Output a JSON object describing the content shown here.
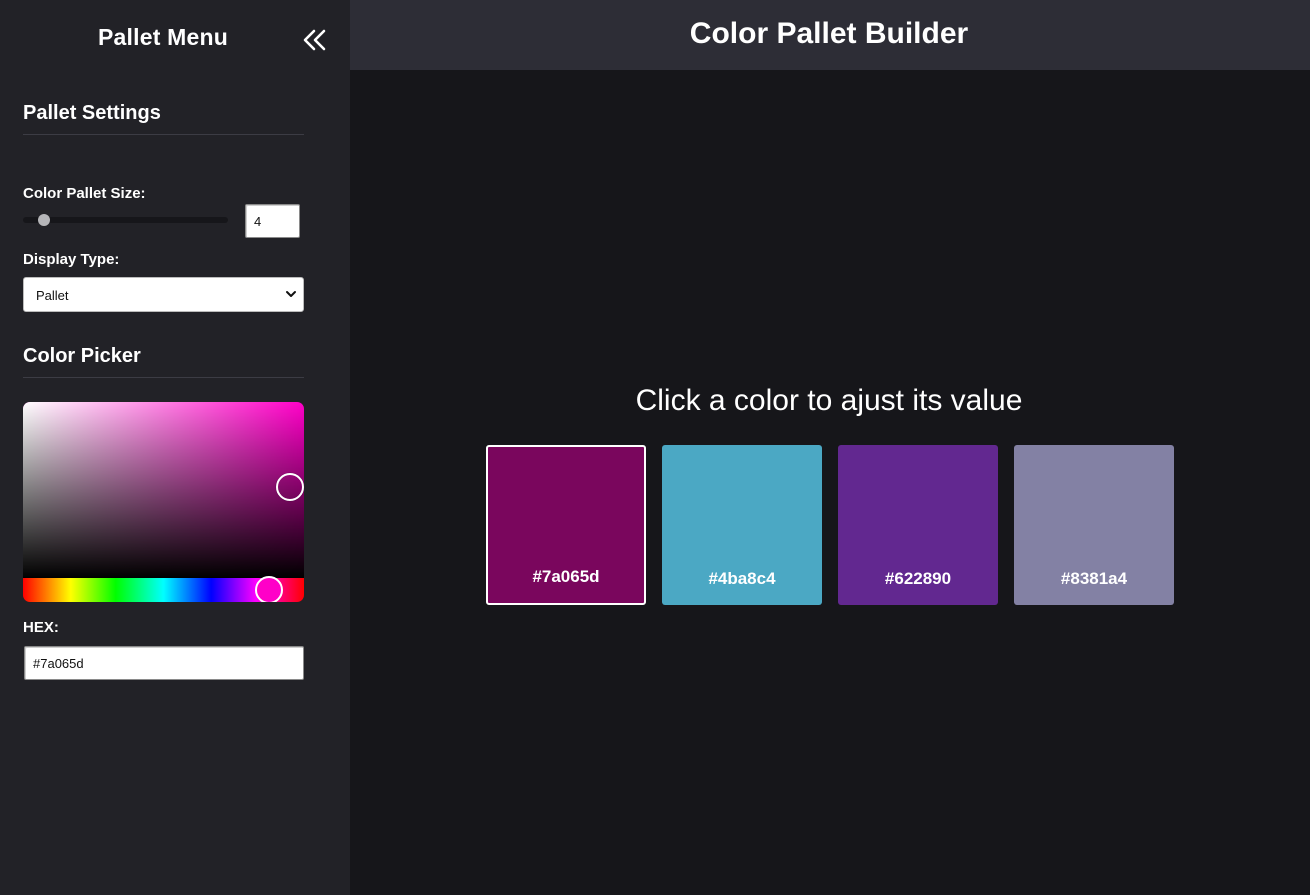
{
  "sidebar": {
    "title": "Pallet Menu",
    "collapse_icon": "double-chevron-left-icon",
    "settings_heading": "Pallet Settings",
    "size_label": "Color Pallet Size:",
    "size_value": "4",
    "display_label": "Display Type:",
    "display_value": "Pallet",
    "picker_heading": "Color Picker",
    "hex_label": "HEX:",
    "hex_value": "#7a065d"
  },
  "header": {
    "title": "Color Pallet Builder"
  },
  "main": {
    "instruction": "Click a color to ajust its value",
    "swatches": [
      {
        "hex": "#7a065d",
        "color": "#7a065d",
        "selected": true
      },
      {
        "hex": "#4ba8c4",
        "color": "#4ba8c4",
        "selected": false
      },
      {
        "hex": "#622890",
        "color": "#622890",
        "selected": false
      },
      {
        "hex": "#8381a4",
        "color": "#8381a4",
        "selected": false
      }
    ]
  },
  "colors": {
    "sidebar_bg": "#222227",
    "header_bg": "#2d2d36",
    "main_bg": "#16161a",
    "picker_hue": "#ff00c8"
  }
}
